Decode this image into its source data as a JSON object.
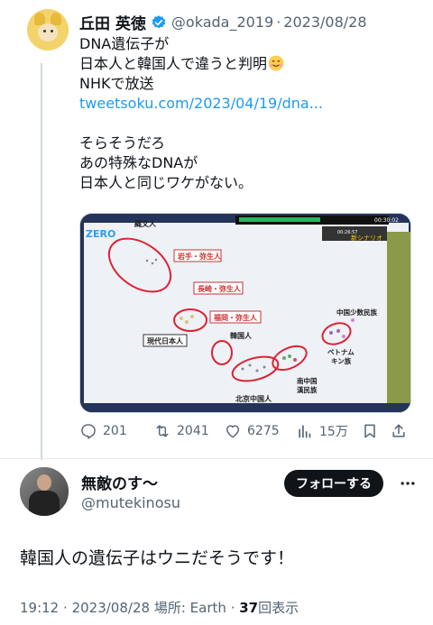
{
  "quoted_tweet": {
    "author_name": "丘田 英徳",
    "handle": "@okada_2019",
    "separator": "·",
    "date": "2023/08/28",
    "lines": [
      "DNA遺伝子が",
      "日本人と韓国人で違うと判明",
      "NHKで放送"
    ],
    "link": "tweetsoku.com/2023/04/19/dna...",
    "lines2": [
      "そらそうだろ",
      "あの特殊なDNAが",
      "日本人と同じワケがない。"
    ],
    "media": {
      "logo": "ZERO",
      "time_top": "00:30:02",
      "time_small": "00:26:57",
      "labels": {
        "jomon": "縄文人",
        "iwate": "岩手・弥生人",
        "nagasaki": "長崎・弥生人",
        "fukuoka": "福岡・弥生人",
        "gendai": "現代日本人",
        "kankoku": "韓国人",
        "shosu": "中国少数民族",
        "vietnam1": "ベトナム",
        "vietnam2": "キン族",
        "minami1": "南中国",
        "minami2": "漢民族",
        "beijing": "北京中国人",
        "scenario": "新シナリオ"
      }
    },
    "actions": {
      "replies": "201",
      "retweets": "2041",
      "likes": "6275",
      "views": "15万"
    }
  },
  "reply": {
    "author_name": "無敵のす〜",
    "handle": "@mutekinosu",
    "follow_label": "フォローする",
    "text": "韓国人の遺伝子はウニだそうです！",
    "time": "19:12",
    "separator": "·",
    "date": "2023/08/28",
    "location_label": "場所:",
    "location": "Earth",
    "views_count": "37",
    "views_label": "回表示"
  },
  "colors": {
    "text": "#0f1419",
    "secondary": "#536471",
    "link": "#1d9bf0",
    "verified": "#1d9bf0",
    "button_bg": "#0f1419"
  },
  "icons": [
    "verified-badge-icon",
    "smiling-emoji-icon",
    "reply-icon",
    "retweet-icon",
    "like-icon",
    "views-icon",
    "bookmark-icon",
    "share-icon",
    "more-icon"
  ]
}
